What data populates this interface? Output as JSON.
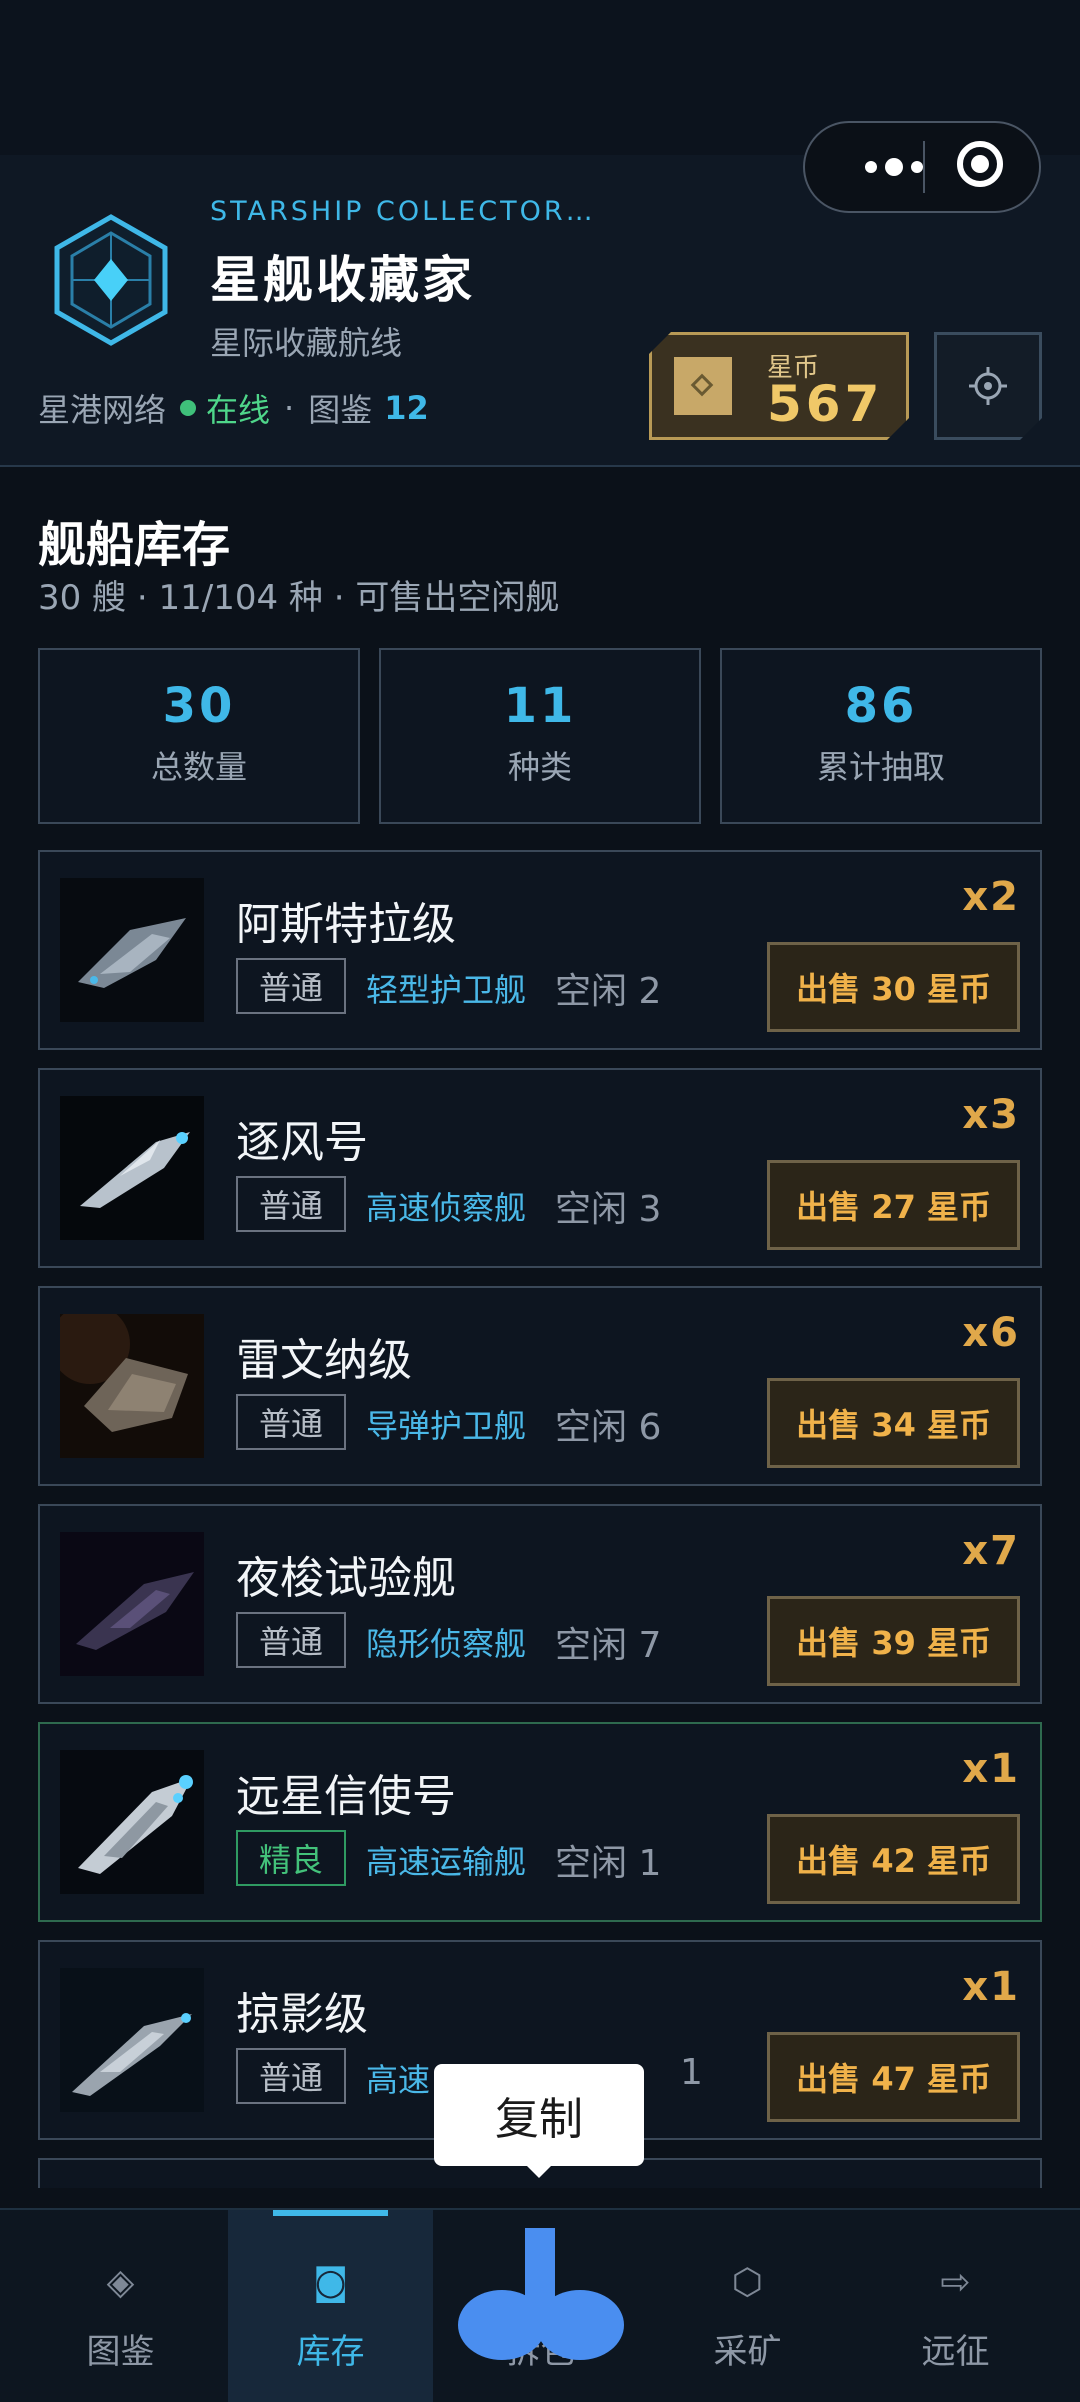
{
  "header": {
    "brand_en": "STARSHIP COLLECTOR…",
    "brand_cn": "星舰收藏家",
    "brand_sub": "星际收藏航线",
    "network_label": "星港网络",
    "online_label": "在线",
    "dot_sep": "·",
    "codex_label": "图鉴",
    "codex_count": "12",
    "coin_label": "星币",
    "coin_value": "567"
  },
  "inventory": {
    "title": "舰船库存",
    "subtitle": "30 艘 · 11/104 种 · 可售出空闲舰",
    "stats": [
      {
        "value": "30",
        "label": "总数量"
      },
      {
        "value": "11",
        "label": "种类"
      },
      {
        "value": "86",
        "label": "累计抽取"
      }
    ],
    "ships": [
      {
        "name": "阿斯特拉级",
        "rarity": "普通",
        "class": "轻型护卫舰",
        "idle": "空闲 2",
        "count": "x2",
        "sell": "出售 30 星币"
      },
      {
        "name": "逐风号",
        "rarity": "普通",
        "class": "高速侦察舰",
        "idle": "空闲 3",
        "count": "x3",
        "sell": "出售 27 星币"
      },
      {
        "name": "雷文纳级",
        "rarity": "普通",
        "class": "导弹护卫舰",
        "idle": "空闲 6",
        "count": "x6",
        "sell": "出售 34 星币"
      },
      {
        "name": "夜梭试验舰",
        "rarity": "普通",
        "class": "隐形侦察舰",
        "idle": "空闲 7",
        "count": "x7",
        "sell": "出售 39 星币"
      },
      {
        "name": "远星信使号",
        "rarity": "精良",
        "class": "高速运输舰",
        "idle": "空闲 1",
        "count": "x1",
        "sell": "出售 42 星币"
      },
      {
        "name": "掠影级",
        "rarity": "普通",
        "class": "高速",
        "idle": "1",
        "count": "x1",
        "sell": "出售 47 星币"
      }
    ]
  },
  "tabbar": {
    "tabs": [
      {
        "label": "图鉴",
        "icon": "diamond-icon"
      },
      {
        "label": "库存",
        "icon": "box-icon"
      },
      {
        "label": "拆包",
        "icon": "sparkle-icon"
      },
      {
        "label": "采矿",
        "icon": "hexagon-icon"
      },
      {
        "label": "远征",
        "icon": "arrow-right-icon"
      }
    ],
    "active": "库存"
  },
  "context_menu": {
    "copy_label": "复制"
  },
  "colors": {
    "background": "#0b1119",
    "accent_blue": "#3fb8e8",
    "gold": "#f0b24a",
    "online_green": "#3fc07a"
  }
}
